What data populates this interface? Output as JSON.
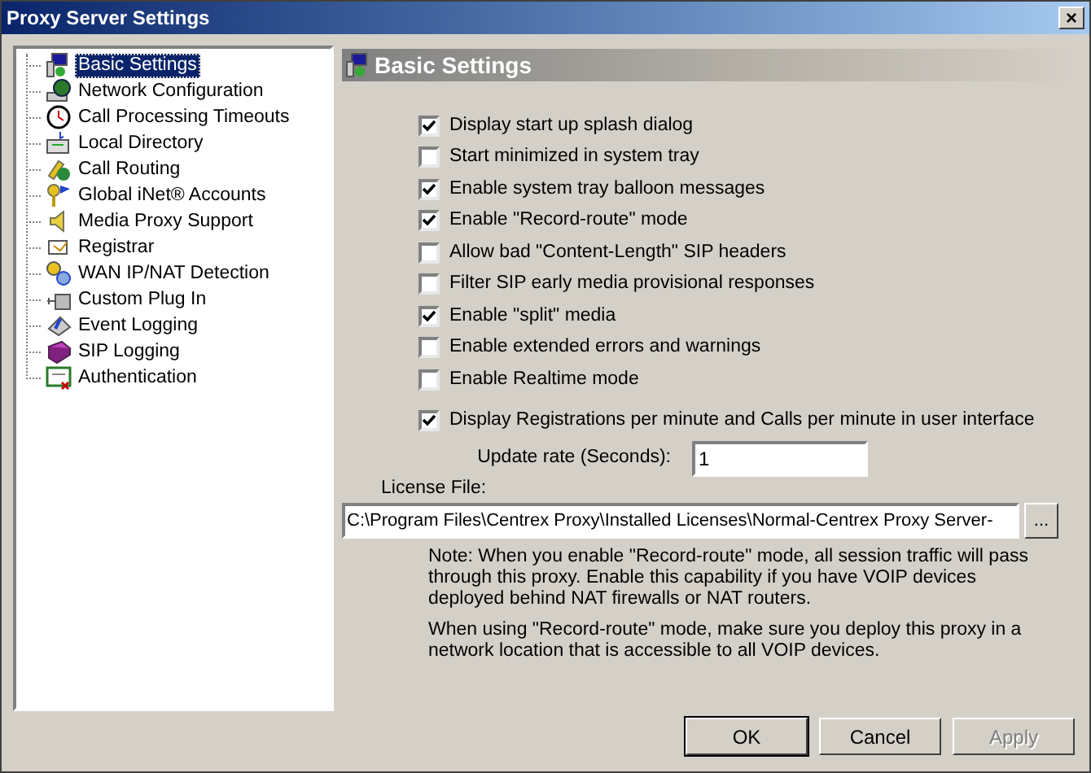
{
  "window": {
    "title": "Proxy Server Settings",
    "close": "×"
  },
  "sidebar": {
    "items": [
      {
        "label": "Basic Settings",
        "selected": true
      },
      {
        "label": "Network Configuration",
        "selected": false
      },
      {
        "label": "Call Processing Timeouts",
        "selected": false
      },
      {
        "label": "Local Directory",
        "selected": false
      },
      {
        "label": "Call Routing",
        "selected": false
      },
      {
        "label": "Global iNet® Accounts",
        "selected": false
      },
      {
        "label": "Media Proxy Support",
        "selected": false
      },
      {
        "label": "Registrar",
        "selected": false
      },
      {
        "label": "WAN IP/NAT Detection",
        "selected": false
      },
      {
        "label": "Custom Plug In",
        "selected": false
      },
      {
        "label": "Event Logging",
        "selected": false
      },
      {
        "label": "SIP Logging",
        "selected": false
      },
      {
        "label": "Authentication",
        "selected": false
      }
    ]
  },
  "panel": {
    "title": "Basic Settings",
    "options": [
      {
        "label": "Display start up splash dialog",
        "checked": true
      },
      {
        "label": "Start minimized in system tray",
        "checked": false
      },
      {
        "label": "Enable system tray balloon messages",
        "checked": true
      },
      {
        "label": "Enable \"Record-route\" mode",
        "checked": true
      },
      {
        "label": "Allow bad \"Content-Length\" SIP headers",
        "checked": false
      },
      {
        "label": "Filter SIP early media provisional responses",
        "checked": false
      },
      {
        "label": "Enable \"split\" media",
        "checked": true
      },
      {
        "label": "Enable extended errors and warnings",
        "checked": false
      },
      {
        "label": "Enable Realtime mode",
        "checked": false
      }
    ],
    "stats_option": {
      "label": "Display Registrations per minute and Calls per minute in user interface",
      "checked": true
    },
    "update_rate": {
      "label": "Update rate (Seconds):",
      "value": "1"
    },
    "license_file": {
      "label": "License File:",
      "value": "C:\\Program Files\\Centrex Proxy\\Installed Licenses\\Normal-Centrex Proxy Server-",
      "browse": "..."
    },
    "notes": [
      "Note: When you enable \"Record-route\" mode, all session traffic will pass through this proxy. Enable this capability if you have VOIP devices deployed behind NAT firewalls or NAT routers.",
      "When using \"Record-route\" mode, make sure you deploy this proxy in a network location that is accessible to all VOIP devices."
    ]
  },
  "buttons": [
    {
      "label": "OK",
      "disabled": false,
      "default": true
    },
    {
      "label": "Cancel",
      "disabled": false,
      "default": false
    },
    {
      "label": "Apply",
      "disabled": true,
      "default": false
    }
  ]
}
